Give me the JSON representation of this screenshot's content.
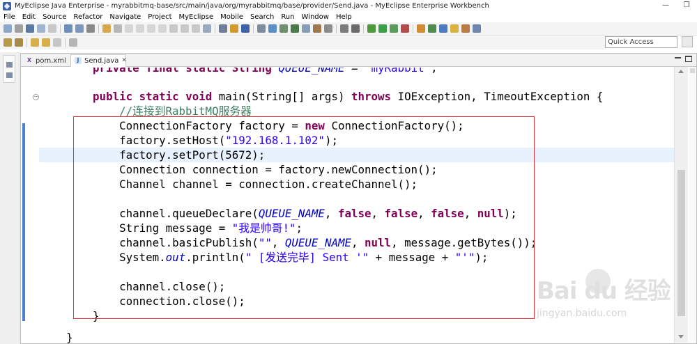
{
  "window": {
    "title": "MyEclipse Java Enterprise - myrabbitmq-base/src/main/java/org/myrabbitmq/base/provider/Send.java - MyEclipse Enterprise Workbench",
    "minimize": "—",
    "restore": "❐"
  },
  "menu": [
    "File",
    "Edit",
    "Source",
    "Refactor",
    "Navigate",
    "Project",
    "MyEclipse",
    "Mobile",
    "Search",
    "Run",
    "Window",
    "Help"
  ],
  "toolbar": {
    "quick_access_placeholder": "Quick Access"
  },
  "tabs": [
    {
      "label": "pom.xml",
      "icon": "xml-file-icon",
      "active": false
    },
    {
      "label": "Send.java",
      "icon": "java-file-icon",
      "active": true
    }
  ],
  "code": {
    "line0": {
      "a": "    private final static String ",
      "b": "QUEUE_NAME",
      "c": " = ",
      "d": "\"myRabbit\"",
      "e": ";"
    },
    "line1": {
      "a": "    public static void ",
      "b": "main(String[] args) ",
      "c": "throws",
      "d": " IOException, TimeoutException {"
    },
    "line2": {
      "a": "        //连接到RabbitMQ服务器"
    },
    "line3": {
      "a": "        ConnectionFactory factory = ",
      "b": "new",
      "c": " ConnectionFactory();"
    },
    "line4": {
      "a": "        factory.setHost(",
      "b": "\"192.168.1.102\"",
      "c": ");"
    },
    "line5": {
      "a": "        factory.setPort(5672);"
    },
    "line6": {
      "a": "        Connection connection = factory.newConnection();"
    },
    "line7": {
      "a": "        Channel channel = connection.createChannel();"
    },
    "line8": {
      "a": "        channel.queueDeclare(",
      "b": "QUEUE_NAME",
      "c": ", ",
      "d": "false",
      "e": ", ",
      "f": "false",
      "g": ", ",
      "h": "false",
      "i": ", ",
      "j": "null",
      "k": ");"
    },
    "line9": {
      "a": "        String message = ",
      "b": "\"我是帅哥!\"",
      "c": ";"
    },
    "line10": {
      "a": "        channel.basicPublish(",
      "b": "\"\"",
      "c": ", ",
      "d": "QUEUE_NAME",
      "e": ", ",
      "f": "null",
      "g": ", message.getBytes());"
    },
    "line11": {
      "a": "        System.",
      "b": "out",
      "c": ".println(",
      "d": "\" [发送完毕] Sent '\"",
      "e": " + message + ",
      "f": "\"'\"",
      "g": ");"
    },
    "line12": {
      "a": "        channel.close();"
    },
    "line13": {
      "a": "        connection.close();"
    },
    "line14": {
      "a": "    }"
    },
    "line15": {
      "a": "}"
    }
  },
  "watermark": {
    "logo": "Bai du 经验",
    "url": "jingyan.baidu.com"
  },
  "colors": {
    "keyword": "#7f0055",
    "string": "#2a00ff",
    "static_field": "#0000c0",
    "comment": "#3f7f5f",
    "highlight_box": "#e0333a",
    "current_line": "#e8f2fe"
  }
}
